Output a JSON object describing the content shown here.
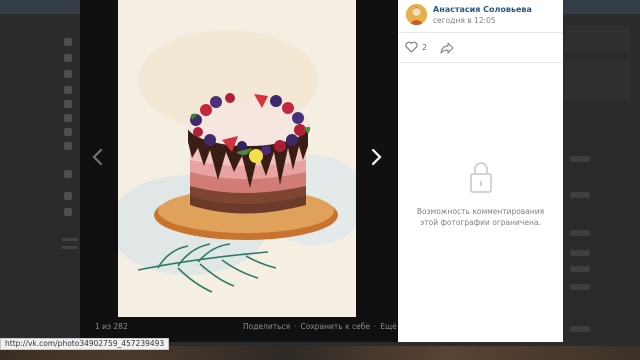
{
  "viewer": {
    "counter": "1 из 282",
    "actions": {
      "share": "Поделиться",
      "separator": "·",
      "save": "Сохранить к себе",
      "more": "Ещё"
    }
  },
  "sidebar": {
    "author_name": "Анастасия Соловьева",
    "post_time": "сегодня в 12:05",
    "likes": "2",
    "comments_locked_text": "Возможность комментирования этой фотографии ограничена."
  },
  "status_bar": {
    "url": "http://vk.com/photo34902759_457239493"
  },
  "icons": {
    "like": "heart-icon",
    "share": "share-arrow-icon",
    "lock": "lock-icon",
    "prev": "chevron-left-icon",
    "next": "chevron-right-icon",
    "more": "chevron-down-icon"
  },
  "colors": {
    "link": "#2a5885",
    "overlay": "#0e0e0e",
    "panel": "#ffffff"
  }
}
